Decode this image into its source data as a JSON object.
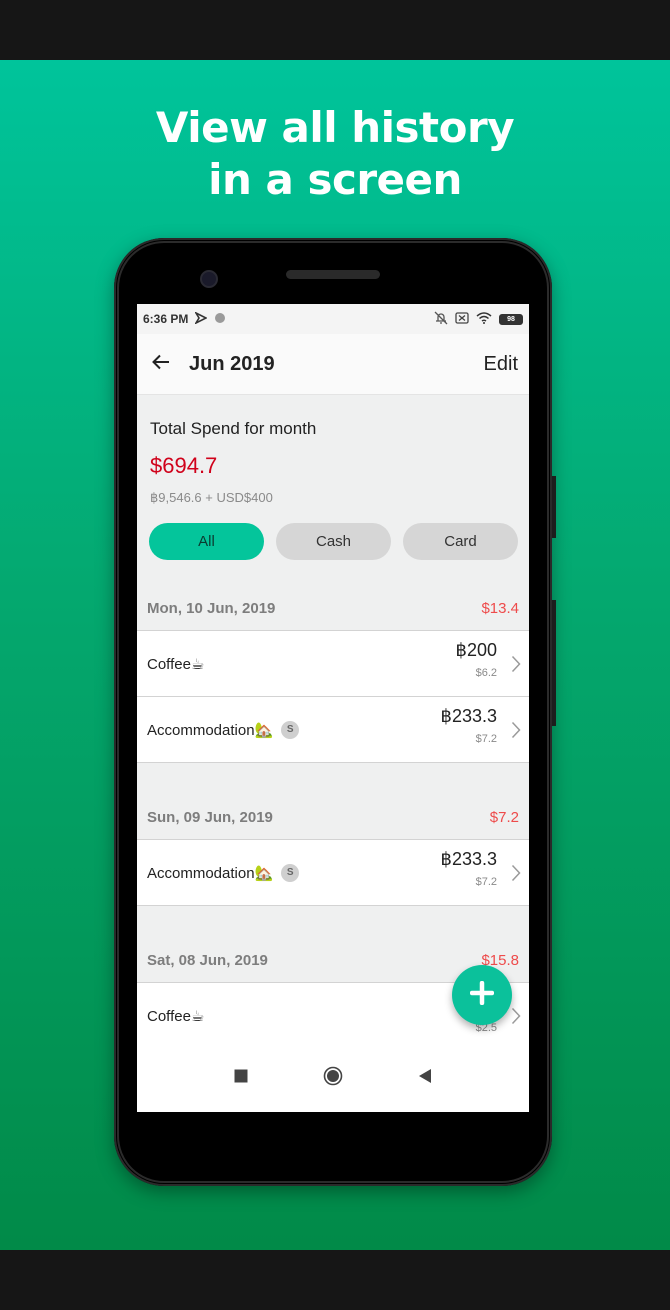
{
  "promo": {
    "headline_line1": "View all history",
    "headline_line2": "in a screen"
  },
  "status_bar": {
    "time": "6:36 PM",
    "battery": "98"
  },
  "app_bar": {
    "title": "Jun 2019",
    "edit_label": "Edit"
  },
  "summary": {
    "label": "Total Spend for month",
    "amount": "$694.7",
    "breakdown": "฿9,546.6 + USD$400"
  },
  "filters": [
    {
      "label": "All",
      "selected": true
    },
    {
      "label": "Cash",
      "selected": false
    },
    {
      "label": "Card",
      "selected": false
    }
  ],
  "days": [
    {
      "date": "Mon, 10 Jun, 2019",
      "total": "$13.4",
      "transactions": [
        {
          "name": "Coffee☕",
          "amount": "฿200",
          "converted": "$6.2",
          "badge": null
        },
        {
          "name": "Accommodation🏡",
          "amount": "฿233.3",
          "converted": "$7.2",
          "badge": "S"
        }
      ]
    },
    {
      "date": "Sun, 09 Jun, 2019",
      "total": "$7.2",
      "transactions": [
        {
          "name": "Accommodation🏡",
          "amount": "฿233.3",
          "converted": "$7.2",
          "badge": "S"
        }
      ]
    },
    {
      "date": "Sat, 08 Jun, 2019",
      "total": "$15.8",
      "transactions": [
        {
          "name": "Coffee☕",
          "amount": "",
          "converted": "$2.5",
          "badge": null
        }
      ]
    }
  ],
  "colors": {
    "accent": "#04c59b",
    "amount_red": "#d0021b",
    "day_total_red": "#ee4b4b"
  },
  "icons": {
    "back": "arrow-left-icon",
    "chevron": "chevron-right-icon",
    "fab": "plus-icon",
    "nav_recent": "square-icon",
    "nav_home": "circle-icon",
    "nav_back": "triangle-back-icon"
  }
}
